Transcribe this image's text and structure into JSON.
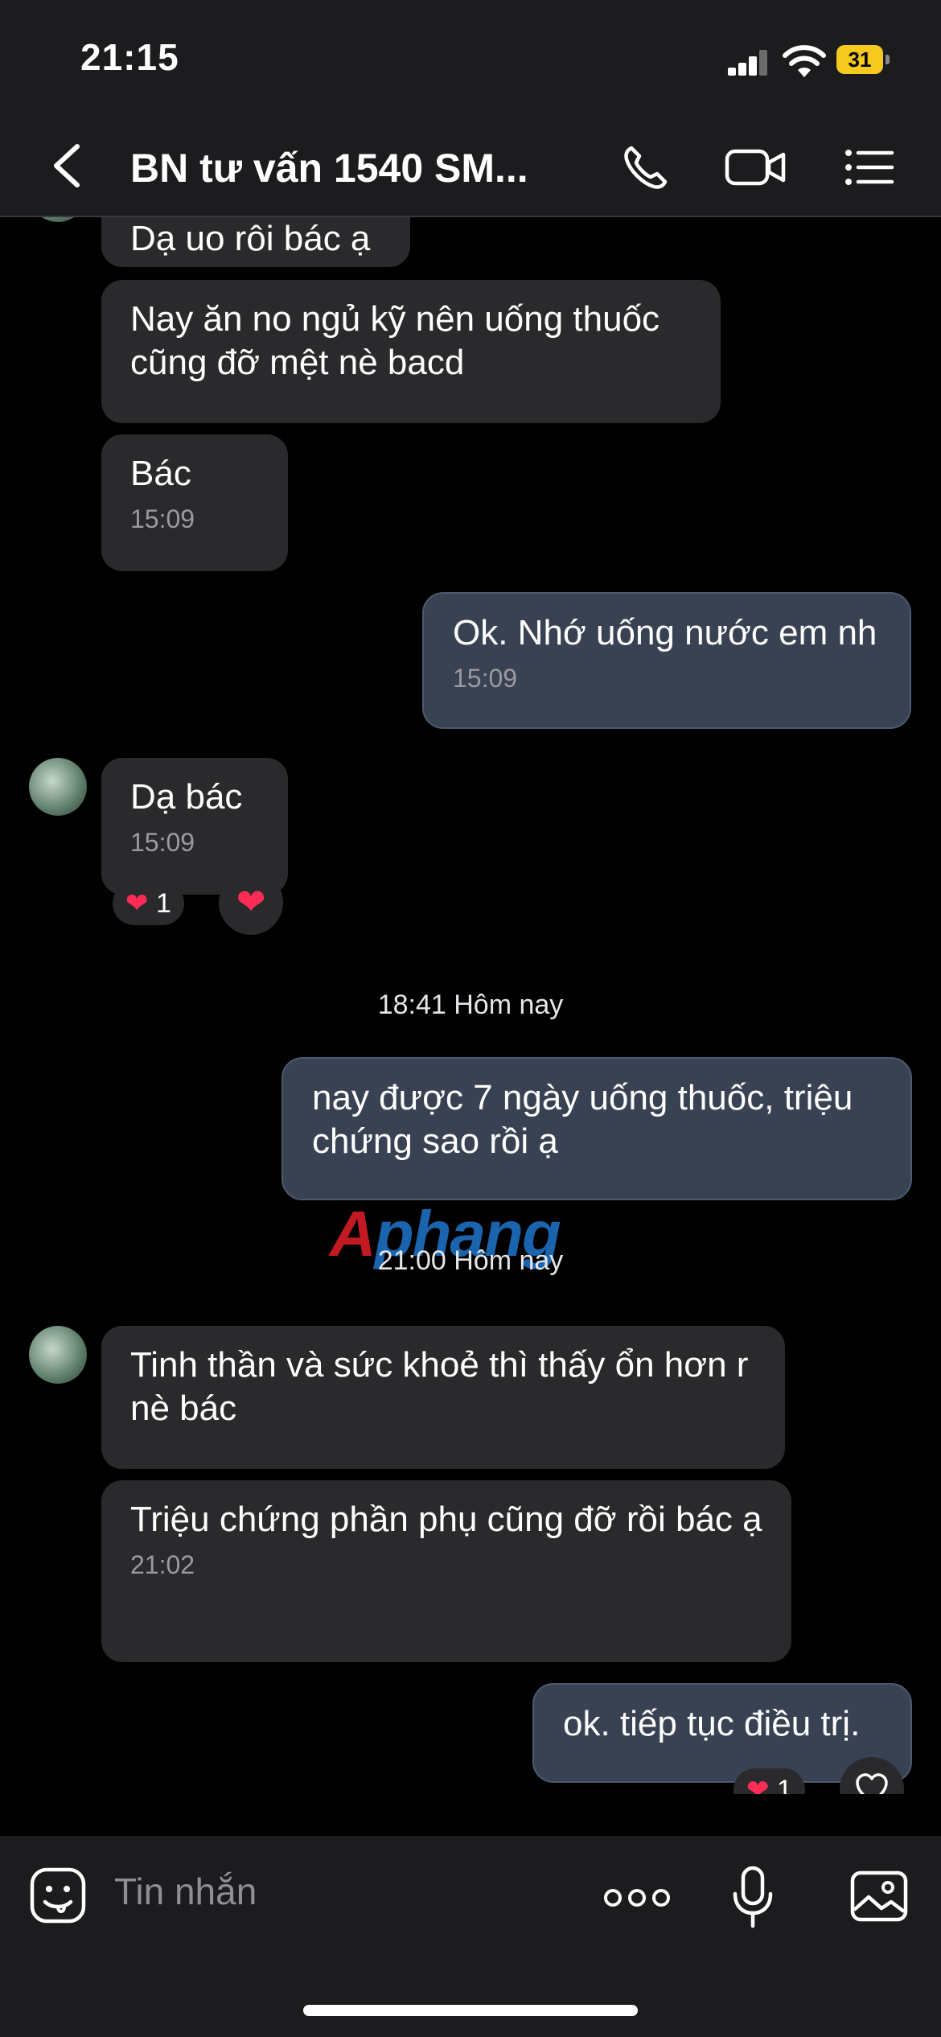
{
  "status_bar": {
    "time": "21:15",
    "battery": "31"
  },
  "header": {
    "title": "BN tư vấn 1540 SM...",
    "icons": [
      "back-chevron-icon",
      "phone-icon",
      "video-camera-icon",
      "list-menu-icon"
    ]
  },
  "messages": [
    {
      "side": "in",
      "text": "Dạ uo rôi bác ạ"
    },
    {
      "side": "in",
      "text": "Nay ăn no ngủ kỹ nên uống thuốc cũng đỡ mệt nè bacd"
    },
    {
      "side": "in",
      "text": "Bác",
      "time": "15:09"
    },
    {
      "side": "out",
      "text": "Ok. Nhớ uống nước em nh",
      "time": "15:09"
    },
    {
      "side": "in",
      "text": "Dạ bác",
      "time": "15:09",
      "reaction_count": "1"
    },
    {
      "side": "out",
      "text": "nay được 7 ngày uống thuốc, triệu chứng sao rồi ạ"
    },
    {
      "side": "in",
      "text": "Tinh thần và sức khoẻ thì thấy ổn hơn r nè bác"
    },
    {
      "side": "in",
      "text": "Triệu chứng phần phụ cũng đỡ rồi bác ạ",
      "time": "21:02"
    },
    {
      "side": "out",
      "text": "ok. tiếp tục điều trị.",
      "reaction_count": "1"
    }
  ],
  "separators": [
    "18:41 Hôm nay",
    "21:00 Hôm nay"
  ],
  "watermark": {
    "first": "A",
    "rest": "phang"
  },
  "composer": {
    "placeholder": "Tin nhắn"
  },
  "colors": {
    "incoming_bubble": "#2a2a2c",
    "outgoing_bubble": "#394253",
    "heart": "#ff2d55",
    "battery": "#f5c91d"
  }
}
